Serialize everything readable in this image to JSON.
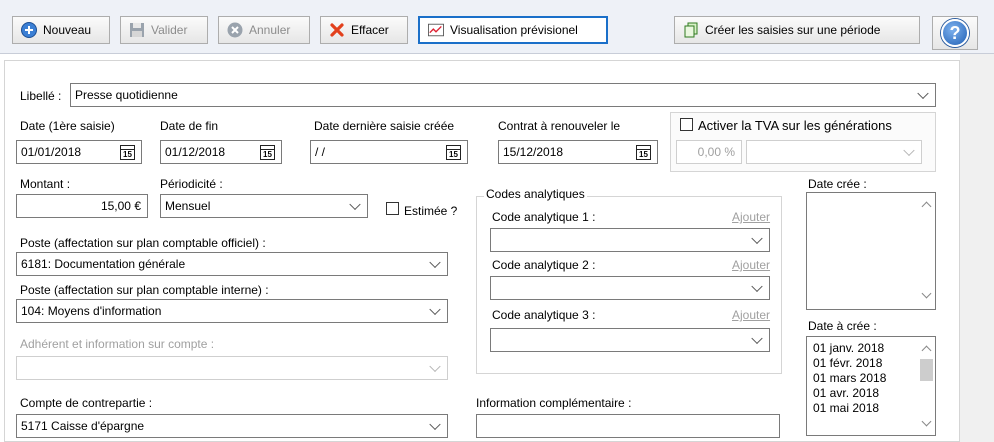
{
  "toolbar": {
    "nouveau": "Nouveau",
    "valider": "Valider",
    "annuler": "Annuler",
    "effacer": "Effacer",
    "visualisation": "Visualisation prévisionel",
    "creer_saisies": "Créer les saisies sur une période",
    "help_icon": "?"
  },
  "form": {
    "libelle_label": "Libellé :",
    "libelle_value": "Presse quotidienne",
    "date_premiere_label": "Date (1ère saisie)",
    "date_premiere_value": "01/01/2018",
    "date_fin_label": "Date de fin",
    "date_fin_value": "01/12/2018",
    "date_derniere_label": "Date dernière saisie créée",
    "date_derniere_value": "/ /",
    "contrat_label": "Contrat à renouveler le",
    "contrat_value": "15/12/2018",
    "calendar_icon_text": "15",
    "tva_label": "Activer la TVA sur les générations",
    "tva_rate": "0,00 %",
    "montant_label": "Montant :",
    "montant_value": "15,00 €",
    "periodicite_label": "Périodicité :",
    "periodicite_value": "Mensuel",
    "estimee_label": "Estimée ?",
    "codes_title": "Codes analytiques",
    "code1_label": "Code analytique 1 :",
    "code2_label": "Code analytique 2 :",
    "code3_label": "Code analytique 3 :",
    "ajouter": "Ajouter",
    "date_cree_label": "Date crée :",
    "date_a_cree_label": "Date à crée :",
    "dates_a_creer": [
      "01 janv. 2018",
      "01 févr. 2018",
      "01 mars 2018",
      "01 avr. 2018",
      "01 mai 2018"
    ],
    "poste_officiel_label": "Poste (affectation sur plan comptable officiel) :",
    "poste_officiel_value": "6181: Documentation générale",
    "poste_interne_label": "Poste (affectation sur plan comptable interne) :",
    "poste_interne_value": "104: Moyens d'information",
    "adherent_label": "Adhérent et information sur compte :",
    "contrepartie_label": "Compte de contrepartie :",
    "contrepartie_value": "5171  Caisse d'épargne",
    "info_comp_label": "Information complémentaire :"
  }
}
